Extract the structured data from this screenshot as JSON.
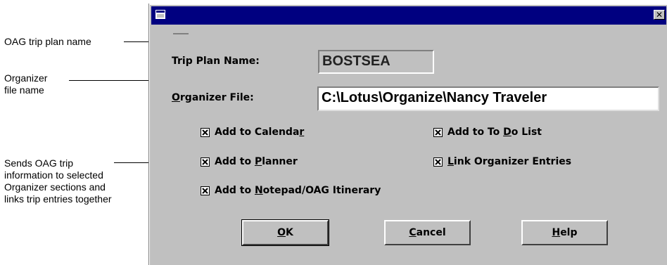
{
  "callouts": {
    "trip_plan_name": "OAG trip plan name",
    "organizer_file": "Organizer\nfile name",
    "sends": "Sends OAG trip\ninformation to selected\nOrganizer sections and\nlinks trip entries together"
  },
  "dialog": {
    "close_glyph": "✕",
    "trip_plan_label": "Trip Plan Name:",
    "trip_plan_value": "BOSTSEA",
    "organizer_label_u": "O",
    "organizer_label_rest": "rganizer File:",
    "organizer_value": "C:\\Lotus\\Organize\\Nancy Traveler",
    "check": {
      "calendar_a": "Add to Calenda",
      "calendar_u": "r",
      "calendar_b": "",
      "planner_a": "Add to ",
      "planner_u": "P",
      "planner_b": "lanner",
      "notepad_a": "Add to ",
      "notepad_u": "N",
      "notepad_b": "otepad/OAG Itinerary",
      "todo_a": "Add to To ",
      "todo_u": "D",
      "todo_b": "o List",
      "link_a": "",
      "link_u": "L",
      "link_b": "ink Organizer Entries"
    },
    "buttons": {
      "ok_u": "O",
      "ok_rest": "K",
      "cancel_u": "C",
      "cancel_rest": "ancel",
      "help_u": "H",
      "help_rest": "elp"
    }
  },
  "colors": {
    "titlebar": "#000080",
    "face": "#c0c0c0"
  }
}
